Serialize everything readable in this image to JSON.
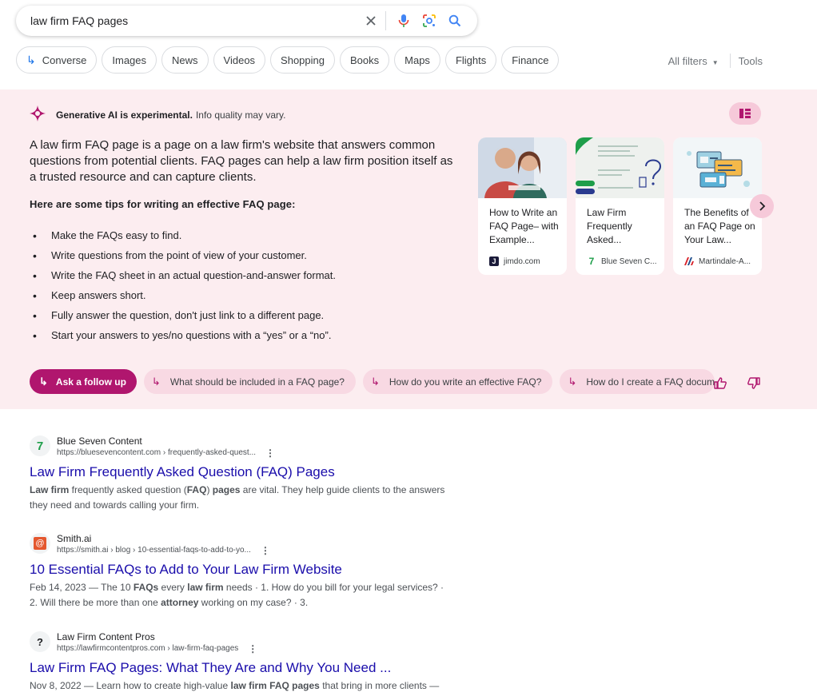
{
  "search": {
    "query": "law firm FAQ pages"
  },
  "chips": [
    {
      "label": "Converse",
      "icon": "converse-arrow-icon"
    },
    {
      "label": "Images"
    },
    {
      "label": "News"
    },
    {
      "label": "Videos"
    },
    {
      "label": "Shopping"
    },
    {
      "label": "Books"
    },
    {
      "label": "Maps"
    },
    {
      "label": "Flights"
    },
    {
      "label": "Finance"
    }
  ],
  "filters": {
    "all_filters": "All filters",
    "tools": "Tools"
  },
  "ai": {
    "header_bold": "Generative AI is experimental.",
    "header_rest": "Info quality may vary.",
    "summary": "A law firm FAQ page is a page on a law firm's website that answers common questions from potential clients. FAQ pages can help a law firm position itself as a trusted resource and can capture clients.",
    "tips_title": "Here are some tips for writing an effective FAQ page:",
    "tips": [
      "Make the FAQs easy to find.",
      "Write questions from the point of view of your customer.",
      "Write the FAQ sheet in an actual question-and-answer format.",
      "Keep answers short.",
      "Fully answer the question, don't just link to a different page.",
      "Start your answers to yes/no questions with a “yes” or a “no”."
    ],
    "cards": [
      {
        "title": "How to Write an FAQ Page– with Example...",
        "source": "jimdo.com"
      },
      {
        "title": "Law Firm Frequently Asked...",
        "source": "Blue Seven C..."
      },
      {
        "title": "The Benefits of an FAQ Page on Your Law...",
        "source": "Martindale-A..."
      }
    ],
    "followups": {
      "primary": "Ask a follow up",
      "items": [
        "What should be included in a FAQ page?",
        "How do you write an effective FAQ?",
        "How do I create a FAQ document?"
      ]
    }
  },
  "results": [
    {
      "site": "Blue Seven Content",
      "url": "https://bluesevencontent.com › frequently-asked-quest...",
      "title": "Law Firm Frequently Asked Question (FAQ) Pages",
      "snippet": [
        {
          "t": "Law firm",
          "b": true
        },
        {
          "t": " frequently asked question (",
          "b": false
        },
        {
          "t": "FAQ",
          "b": true
        },
        {
          "t": ") ",
          "b": false
        },
        {
          "t": "pages",
          "b": true
        },
        {
          "t": " are vital. They help guide clients to the answers they need and towards calling your firm.",
          "b": false
        }
      ]
    },
    {
      "site": "Smith.ai",
      "url": "https://smith.ai › blog › 10-essential-faqs-to-add-to-yo...",
      "title": "10 Essential FAQs to Add to Your Law Firm Website",
      "snippet": [
        {
          "t": "Feb 14, 2023 — The 10 ",
          "b": false
        },
        {
          "t": "FAQs",
          "b": true
        },
        {
          "t": " every ",
          "b": false
        },
        {
          "t": "law firm",
          "b": true
        },
        {
          "t": " needs · 1. How do you bill for your legal services? · 2. Will there be more than one ",
          "b": false
        },
        {
          "t": "attorney",
          "b": true
        },
        {
          "t": " working on my case? · 3.",
          "b": false
        }
      ]
    },
    {
      "site": "Law Firm Content Pros",
      "url": "https://lawfirmcontentpros.com › law-firm-faq-pages",
      "title": "Law Firm FAQ Pages: What They Are and Why You Need ...",
      "snippet": [
        {
          "t": "Nov 8, 2022 — Learn how to create high-value ",
          "b": false
        },
        {
          "t": "law firm FAQ pages",
          "b": true
        },
        {
          "t": " that bring in more clients —",
          "b": false
        }
      ]
    }
  ],
  "colors": {
    "accent_magenta": "#b0166e",
    "ai_background": "#fcedf0",
    "link_blue": "#1a0dab"
  }
}
